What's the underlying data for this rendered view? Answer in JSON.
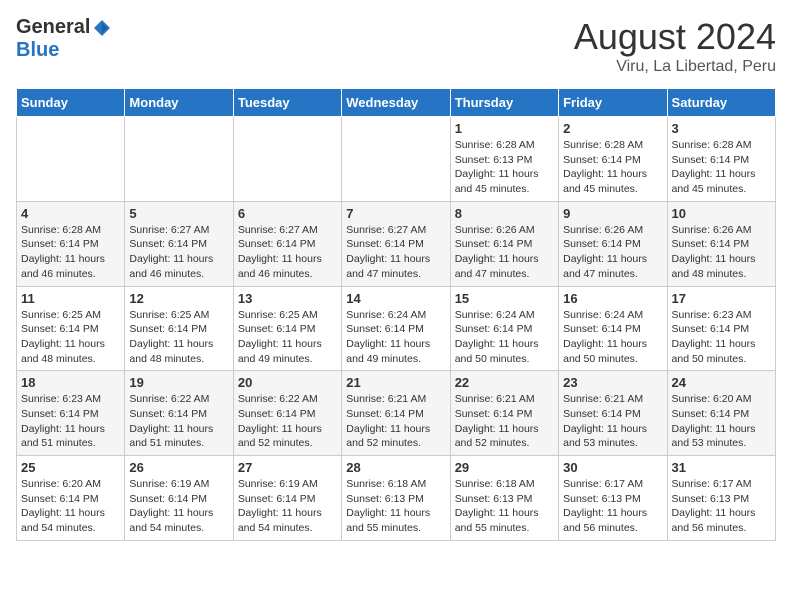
{
  "logo": {
    "general": "General",
    "blue": "Blue"
  },
  "title": "August 2024",
  "subtitle": "Viru, La Libertad, Peru",
  "days_of_week": [
    "Sunday",
    "Monday",
    "Tuesday",
    "Wednesday",
    "Thursday",
    "Friday",
    "Saturday"
  ],
  "weeks": [
    [
      {
        "day": "",
        "info": ""
      },
      {
        "day": "",
        "info": ""
      },
      {
        "day": "",
        "info": ""
      },
      {
        "day": "",
        "info": ""
      },
      {
        "day": "1",
        "info": "Sunrise: 6:28 AM\nSunset: 6:13 PM\nDaylight: 11 hours\nand 45 minutes."
      },
      {
        "day": "2",
        "info": "Sunrise: 6:28 AM\nSunset: 6:14 PM\nDaylight: 11 hours\nand 45 minutes."
      },
      {
        "day": "3",
        "info": "Sunrise: 6:28 AM\nSunset: 6:14 PM\nDaylight: 11 hours\nand 45 minutes."
      }
    ],
    [
      {
        "day": "4",
        "info": "Sunrise: 6:28 AM\nSunset: 6:14 PM\nDaylight: 11 hours\nand 46 minutes."
      },
      {
        "day": "5",
        "info": "Sunrise: 6:27 AM\nSunset: 6:14 PM\nDaylight: 11 hours\nand 46 minutes."
      },
      {
        "day": "6",
        "info": "Sunrise: 6:27 AM\nSunset: 6:14 PM\nDaylight: 11 hours\nand 46 minutes."
      },
      {
        "day": "7",
        "info": "Sunrise: 6:27 AM\nSunset: 6:14 PM\nDaylight: 11 hours\nand 47 minutes."
      },
      {
        "day": "8",
        "info": "Sunrise: 6:26 AM\nSunset: 6:14 PM\nDaylight: 11 hours\nand 47 minutes."
      },
      {
        "day": "9",
        "info": "Sunrise: 6:26 AM\nSunset: 6:14 PM\nDaylight: 11 hours\nand 47 minutes."
      },
      {
        "day": "10",
        "info": "Sunrise: 6:26 AM\nSunset: 6:14 PM\nDaylight: 11 hours\nand 48 minutes."
      }
    ],
    [
      {
        "day": "11",
        "info": "Sunrise: 6:25 AM\nSunset: 6:14 PM\nDaylight: 11 hours\nand 48 minutes."
      },
      {
        "day": "12",
        "info": "Sunrise: 6:25 AM\nSunset: 6:14 PM\nDaylight: 11 hours\nand 48 minutes."
      },
      {
        "day": "13",
        "info": "Sunrise: 6:25 AM\nSunset: 6:14 PM\nDaylight: 11 hours\nand 49 minutes."
      },
      {
        "day": "14",
        "info": "Sunrise: 6:24 AM\nSunset: 6:14 PM\nDaylight: 11 hours\nand 49 minutes."
      },
      {
        "day": "15",
        "info": "Sunrise: 6:24 AM\nSunset: 6:14 PM\nDaylight: 11 hours\nand 50 minutes."
      },
      {
        "day": "16",
        "info": "Sunrise: 6:24 AM\nSunset: 6:14 PM\nDaylight: 11 hours\nand 50 minutes."
      },
      {
        "day": "17",
        "info": "Sunrise: 6:23 AM\nSunset: 6:14 PM\nDaylight: 11 hours\nand 50 minutes."
      }
    ],
    [
      {
        "day": "18",
        "info": "Sunrise: 6:23 AM\nSunset: 6:14 PM\nDaylight: 11 hours\nand 51 minutes."
      },
      {
        "day": "19",
        "info": "Sunrise: 6:22 AM\nSunset: 6:14 PM\nDaylight: 11 hours\nand 51 minutes."
      },
      {
        "day": "20",
        "info": "Sunrise: 6:22 AM\nSunset: 6:14 PM\nDaylight: 11 hours\nand 52 minutes."
      },
      {
        "day": "21",
        "info": "Sunrise: 6:21 AM\nSunset: 6:14 PM\nDaylight: 11 hours\nand 52 minutes."
      },
      {
        "day": "22",
        "info": "Sunrise: 6:21 AM\nSunset: 6:14 PM\nDaylight: 11 hours\nand 52 minutes."
      },
      {
        "day": "23",
        "info": "Sunrise: 6:21 AM\nSunset: 6:14 PM\nDaylight: 11 hours\nand 53 minutes."
      },
      {
        "day": "24",
        "info": "Sunrise: 6:20 AM\nSunset: 6:14 PM\nDaylight: 11 hours\nand 53 minutes."
      }
    ],
    [
      {
        "day": "25",
        "info": "Sunrise: 6:20 AM\nSunset: 6:14 PM\nDaylight: 11 hours\nand 54 minutes."
      },
      {
        "day": "26",
        "info": "Sunrise: 6:19 AM\nSunset: 6:14 PM\nDaylight: 11 hours\nand 54 minutes."
      },
      {
        "day": "27",
        "info": "Sunrise: 6:19 AM\nSunset: 6:14 PM\nDaylight: 11 hours\nand 54 minutes."
      },
      {
        "day": "28",
        "info": "Sunrise: 6:18 AM\nSunset: 6:13 PM\nDaylight: 11 hours\nand 55 minutes."
      },
      {
        "day": "29",
        "info": "Sunrise: 6:18 AM\nSunset: 6:13 PM\nDaylight: 11 hours\nand 55 minutes."
      },
      {
        "day": "30",
        "info": "Sunrise: 6:17 AM\nSunset: 6:13 PM\nDaylight: 11 hours\nand 56 minutes."
      },
      {
        "day": "31",
        "info": "Sunrise: 6:17 AM\nSunset: 6:13 PM\nDaylight: 11 hours\nand 56 minutes."
      }
    ]
  ]
}
